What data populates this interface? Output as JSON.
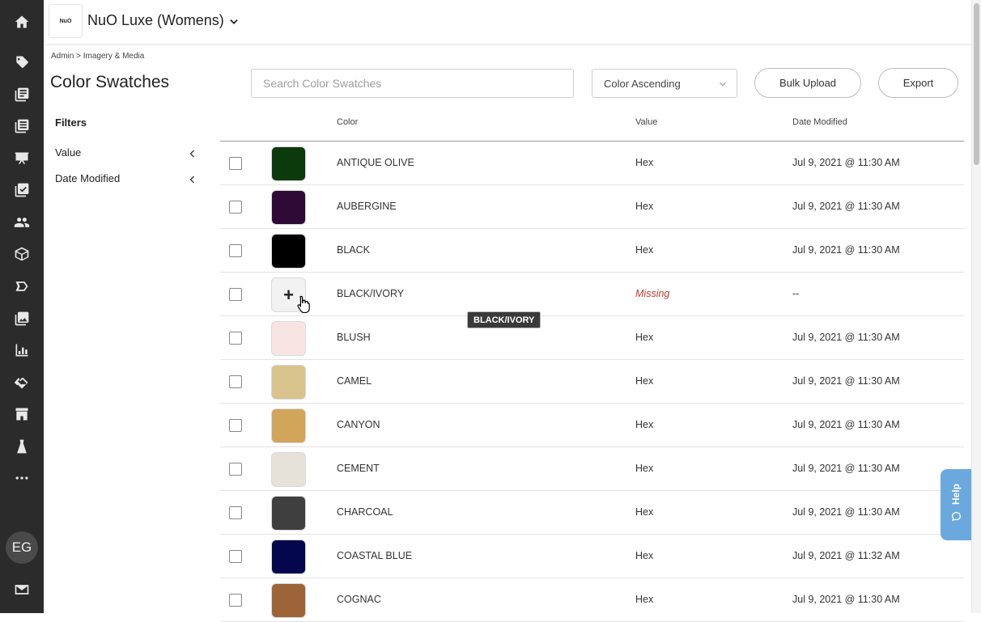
{
  "app": {
    "brand_logo_text": "NuO",
    "brand_name": "NuO Luxe (Womens)"
  },
  "sidebar": {
    "avatar_initials": "EG"
  },
  "breadcrumb": "Admin > Imagery & Media",
  "page_title": "Color Swatches",
  "toolbar": {
    "search_placeholder": "Search Color Swatches",
    "sort_value": "Color Ascending",
    "bulk_upload_label": "Bulk Upload",
    "export_label": "Export"
  },
  "filters": {
    "title": "Filters",
    "items": [
      {
        "label": "Value"
      },
      {
        "label": "Date Modified"
      }
    ]
  },
  "table": {
    "columns": [
      "Color",
      "Value",
      "Date Modified"
    ],
    "rows": [
      {
        "color": "ANTIQUE OLIVE",
        "value": "Hex",
        "date": "Jul 9, 2021 @ 11:30 AM",
        "swatch": "#0d3a0c"
      },
      {
        "color": "AUBERGINE",
        "value": "Hex",
        "date": "Jul 9, 2021 @ 11:30 AM",
        "swatch": "#2f0a36"
      },
      {
        "color": "BLACK",
        "value": "Hex",
        "date": "Jul 9, 2021 @ 11:30 AM",
        "swatch": "#000000"
      },
      {
        "color": "BLACK/IVORY",
        "value": "Missing",
        "date": "--",
        "swatch": ""
      },
      {
        "color": "BLUSH",
        "value": "Hex",
        "date": "Jul 9, 2021 @ 11:30 AM",
        "swatch": "#f9e4e4"
      },
      {
        "color": "CAMEL",
        "value": "Hex",
        "date": "Jul 9, 2021 @ 11:30 AM",
        "swatch": "#d8c38c"
      },
      {
        "color": "CANYON",
        "value": "Hex",
        "date": "Jul 9, 2021 @ 11:30 AM",
        "swatch": "#d1a55a"
      },
      {
        "color": "CEMENT",
        "value": "Hex",
        "date": "Jul 9, 2021 @ 11:30 AM",
        "swatch": "#e6e2d9"
      },
      {
        "color": "CHARCOAL",
        "value": "Hex",
        "date": "Jul 9, 2021 @ 11:30 AM",
        "swatch": "#3f3f3f"
      },
      {
        "color": "COASTAL BLUE",
        "value": "Hex",
        "date": "Jul 9, 2021 @ 11:32 AM",
        "swatch": "#05074e"
      },
      {
        "color": "COGNAC",
        "value": "Hex",
        "date": "Jul 9, 2021 @ 11:30 AM",
        "swatch": "#9c6437"
      }
    ]
  },
  "tooltip_text": "BLACK/IVORY",
  "help_label": "Help",
  "colors": {
    "sidebar_bg": "#2b2b2b",
    "missing": "#c0392b",
    "help_tab": "#6aa8de"
  }
}
